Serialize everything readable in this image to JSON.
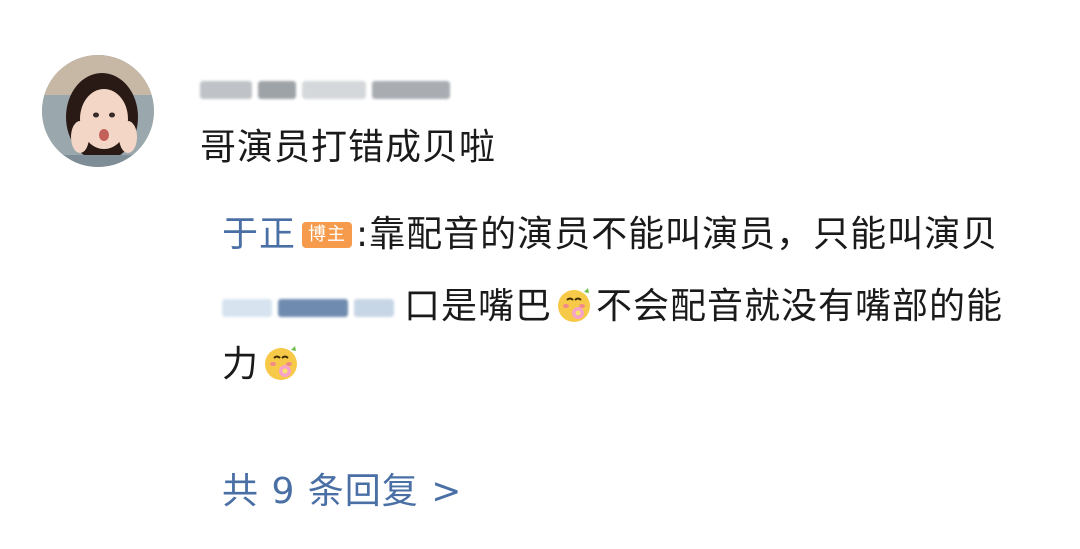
{
  "comment": {
    "text": "哥演员打错成贝啦"
  },
  "replies": [
    {
      "author": "于正",
      "badge": "博主",
      "separator": ":",
      "text": "靠配音的演员不能叫演员，只能叫演贝"
    },
    {
      "text_part1": "口是嘴巴",
      "text_part2": "不会配音就没有嘴部的能力",
      "emoji": "blushing-flower-emoji"
    }
  ],
  "more_replies": {
    "label": "共 9 条回复 >"
  },
  "colors": {
    "link_blue": "#4a6fa5",
    "badge_orange": "#f59b4b",
    "text": "#1a1a1a"
  }
}
